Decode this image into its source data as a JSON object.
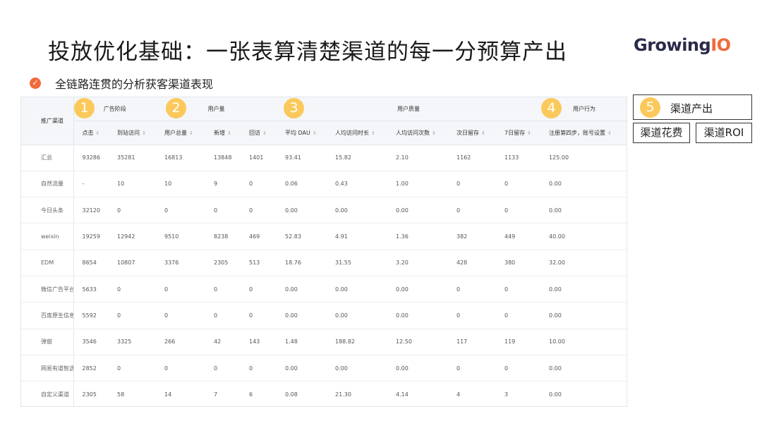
{
  "title": "投放优化基础：一张表算清楚渠道的每一分预算产出",
  "logo": {
    "main": "Growing",
    "accent": "IO"
  },
  "subline": {
    "text": "全链路连贯的分析获客渠道表现"
  },
  "colors": {
    "accent": "#f26a3a",
    "badge": "#fbc95b"
  },
  "badges": [
    "1",
    "2",
    "3",
    "4",
    "5"
  ],
  "table": {
    "channel_header": "推广渠道",
    "groups": [
      "广告阶段",
      "用户量",
      "用户质量",
      "用户行为"
    ],
    "columns": [
      "点击",
      "到站访问",
      "用户总量",
      "新增",
      "回访",
      "平均 DAU",
      "人均访问时长",
      "人均访问次数",
      "次日留存",
      "7日留存",
      "注册第四步，账号设置"
    ],
    "rows": [
      {
        "channel": "汇总",
        "values": [
          "93286",
          "35281",
          "16813",
          "13848",
          "1401",
          "93.41",
          "15.82",
          "2.10",
          "1162",
          "1133",
          "125.00"
        ]
      },
      {
        "channel": "自然流量",
        "values": [
          "-",
          "10",
          "10",
          "9",
          "0",
          "0.06",
          "0.43",
          "1.00",
          "0",
          "0",
          "0.00"
        ]
      },
      {
        "channel": "今日头条",
        "values": [
          "32120",
          "0",
          "0",
          "0",
          "0",
          "0.00",
          "0.00",
          "0.00",
          "0",
          "0",
          "0.00"
        ]
      },
      {
        "channel": "weixin",
        "values": [
          "19259",
          "12942",
          "9510",
          "8238",
          "469",
          "52.83",
          "4.91",
          "1.36",
          "382",
          "449",
          "40.00"
        ]
      },
      {
        "channel": "EDM",
        "values": [
          "8654",
          "10807",
          "3376",
          "2305",
          "513",
          "18.76",
          "31.55",
          "3.20",
          "428",
          "380",
          "32.00"
        ]
      },
      {
        "channel": "微信广告平台",
        "values": [
          "5633",
          "0",
          "0",
          "0",
          "0",
          "0.00",
          "0.00",
          "0.00",
          "0",
          "0",
          "0.00"
        ]
      },
      {
        "channel": "百度原生信息流",
        "values": [
          "5592",
          "0",
          "0",
          "0",
          "0",
          "0.00",
          "0.00",
          "0.00",
          "0",
          "0",
          "0.00"
        ]
      },
      {
        "channel": "弹窗",
        "values": [
          "3546",
          "3325",
          "266",
          "42",
          "143",
          "1.48",
          "188.82",
          "12.50",
          "117",
          "119",
          "10.00"
        ]
      },
      {
        "channel": "网易有道智选",
        "values": [
          "2852",
          "0",
          "0",
          "0",
          "0",
          "0.00",
          "0.00",
          "0.00",
          "0",
          "0",
          "0.00"
        ]
      },
      {
        "channel": "自定义渠道",
        "values": [
          "2305",
          "58",
          "14",
          "7",
          "6",
          "0.08",
          "21.30",
          "4.14",
          "4",
          "3",
          "0.00"
        ]
      }
    ]
  },
  "output_boxes": {
    "output": "渠道产出",
    "spend": "渠道花费",
    "roi": "渠道ROI"
  }
}
